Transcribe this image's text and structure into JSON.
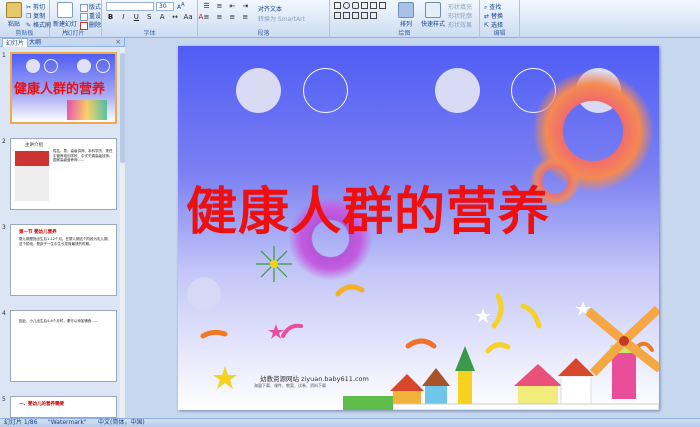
{
  "ribbon": {
    "clipboard": {
      "paste": "粘贴",
      "cut": "剪切",
      "copy": "复制",
      "format_painter": "格式刷",
      "label": "剪贴板"
    },
    "slides": {
      "new_slide": "新建幻灯片",
      "layout": "版式",
      "reset": "重设",
      "delete": "删除",
      "label": "幻灯片"
    },
    "font": {
      "size": "30",
      "label": "字体"
    },
    "paragraph": {
      "convert": "转换为 SmartArt",
      "align_text": "对齐文本",
      "label": "段落"
    },
    "drawing": {
      "arrange": "排列",
      "quick_styles": "快速样式",
      "shape_fill": "形状填充",
      "shape_outline": "形状轮廓",
      "shape_effects": "形状效果",
      "label": "绘图"
    },
    "editing": {
      "find": "查找",
      "replace": "替换",
      "select": "选择",
      "label": "编辑"
    }
  },
  "panel": {
    "tabs": [
      "幻灯片",
      "大纲"
    ],
    "close": "×",
    "slide_numbers": [
      "1",
      "2",
      "3",
      "4",
      "5"
    ],
    "thumb1_title": "健康人群的营养",
    "thumb2_caption": "主讲介绍",
    "thumb2_text": "姓名、男、高级讲师、本科学历，现任中营养培训学校、中式烹调高级技师、国家高级营养师……",
    "thumb3_head": "第一节 婴幼儿营养",
    "thumb3_text": "婴儿期是指出生后1-12个月。在婴儿期这个阶段为乳儿期，这个阶段，是孩子一生中生长发育最快的时期。",
    "thumb4_text": "因此，小儿出生后4-6个月时，便可以添加辅食……",
    "thumb5_head": "一、婴幼儿的营养需要"
  },
  "slide": {
    "title": "健康人群的营养",
    "watermark": "幼教资源网站 ziyuan.baby611.com",
    "watermark_small": "海量下载、课件、教案、试卷、资料下载"
  },
  "status": {
    "slide_info": "幻灯片 1/86",
    "theme": "\"Watermark\"",
    "language": "中文(简体，中国)"
  },
  "colors": {
    "title_red": "#ee1010",
    "ribbon_blue": "#dbe7f7",
    "slide_blue": "#4f5df5"
  }
}
